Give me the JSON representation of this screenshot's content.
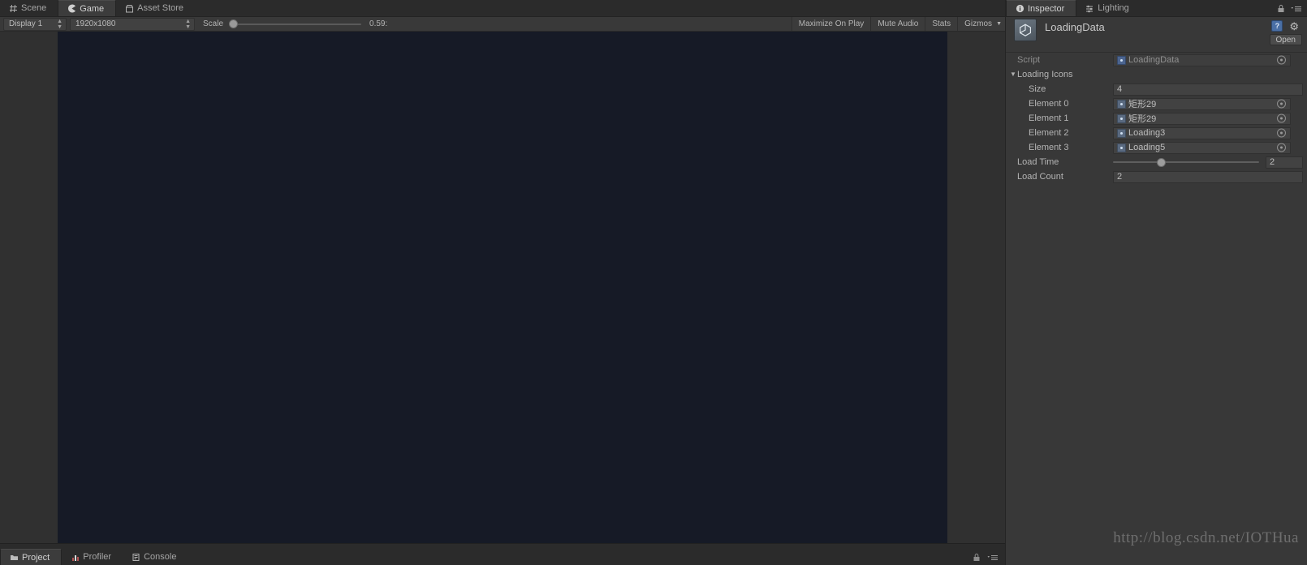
{
  "window": {
    "app": "Unity Editor",
    "watermark": "http://blog.csdn.net/IOTHua"
  },
  "left_dock": {
    "tabs": [
      {
        "label": "Scene",
        "icon": "scene-grid-icon",
        "active": false
      },
      {
        "label": "Game",
        "icon": "game-pacman-icon",
        "active": true
      },
      {
        "label": "Asset Store",
        "icon": "asset-store-icon",
        "active": false
      }
    ]
  },
  "game_toolbar": {
    "display": "Display 1",
    "resolution": "1920x1080",
    "scale_label": "Scale",
    "scale_value": "0.59:",
    "scale_knob_pct": 1,
    "maximize_on_play": "Maximize On Play",
    "mute_audio": "Mute Audio",
    "stats": "Stats",
    "gizmos": "Gizmos"
  },
  "bottom_dock": {
    "tabs": [
      {
        "label": "Project",
        "icon": "folder-icon",
        "active": true
      },
      {
        "label": "Profiler",
        "icon": "profiler-icon",
        "active": false
      },
      {
        "label": "Console",
        "icon": "console-icon",
        "active": false
      }
    ]
  },
  "inspector": {
    "tabs": [
      {
        "label": "Inspector",
        "icon": "info-icon",
        "active": true
      },
      {
        "label": "Lighting",
        "icon": "lighting-sliders-icon",
        "active": false
      }
    ],
    "title": "LoadingData",
    "open_button": "Open",
    "properties": {
      "script": {
        "label": "Script",
        "value": "LoadingData"
      },
      "loading_icons": {
        "label": "Loading Icons",
        "expanded": true,
        "size": {
          "label": "Size",
          "value": "4"
        },
        "elements": [
          {
            "label": "Element 0",
            "value": "矩形29"
          },
          {
            "label": "Element 1",
            "value": "矩形29"
          },
          {
            "label": "Element 2",
            "value": "Loading3"
          },
          {
            "label": "Element 3",
            "value": "Loading5"
          }
        ]
      },
      "load_time": {
        "label": "Load Time",
        "value": "2",
        "slider_pct": 33
      },
      "load_count": {
        "label": "Load Count",
        "value": "2"
      }
    }
  },
  "colors": {
    "chrome": "#383838",
    "tabbar": "#2b2b2b",
    "active_tab": "#3c3c3c",
    "game_background": "#161a26",
    "field": "#424242",
    "text": "#b4b4b4",
    "accent_blue": "#4a6fa5"
  }
}
